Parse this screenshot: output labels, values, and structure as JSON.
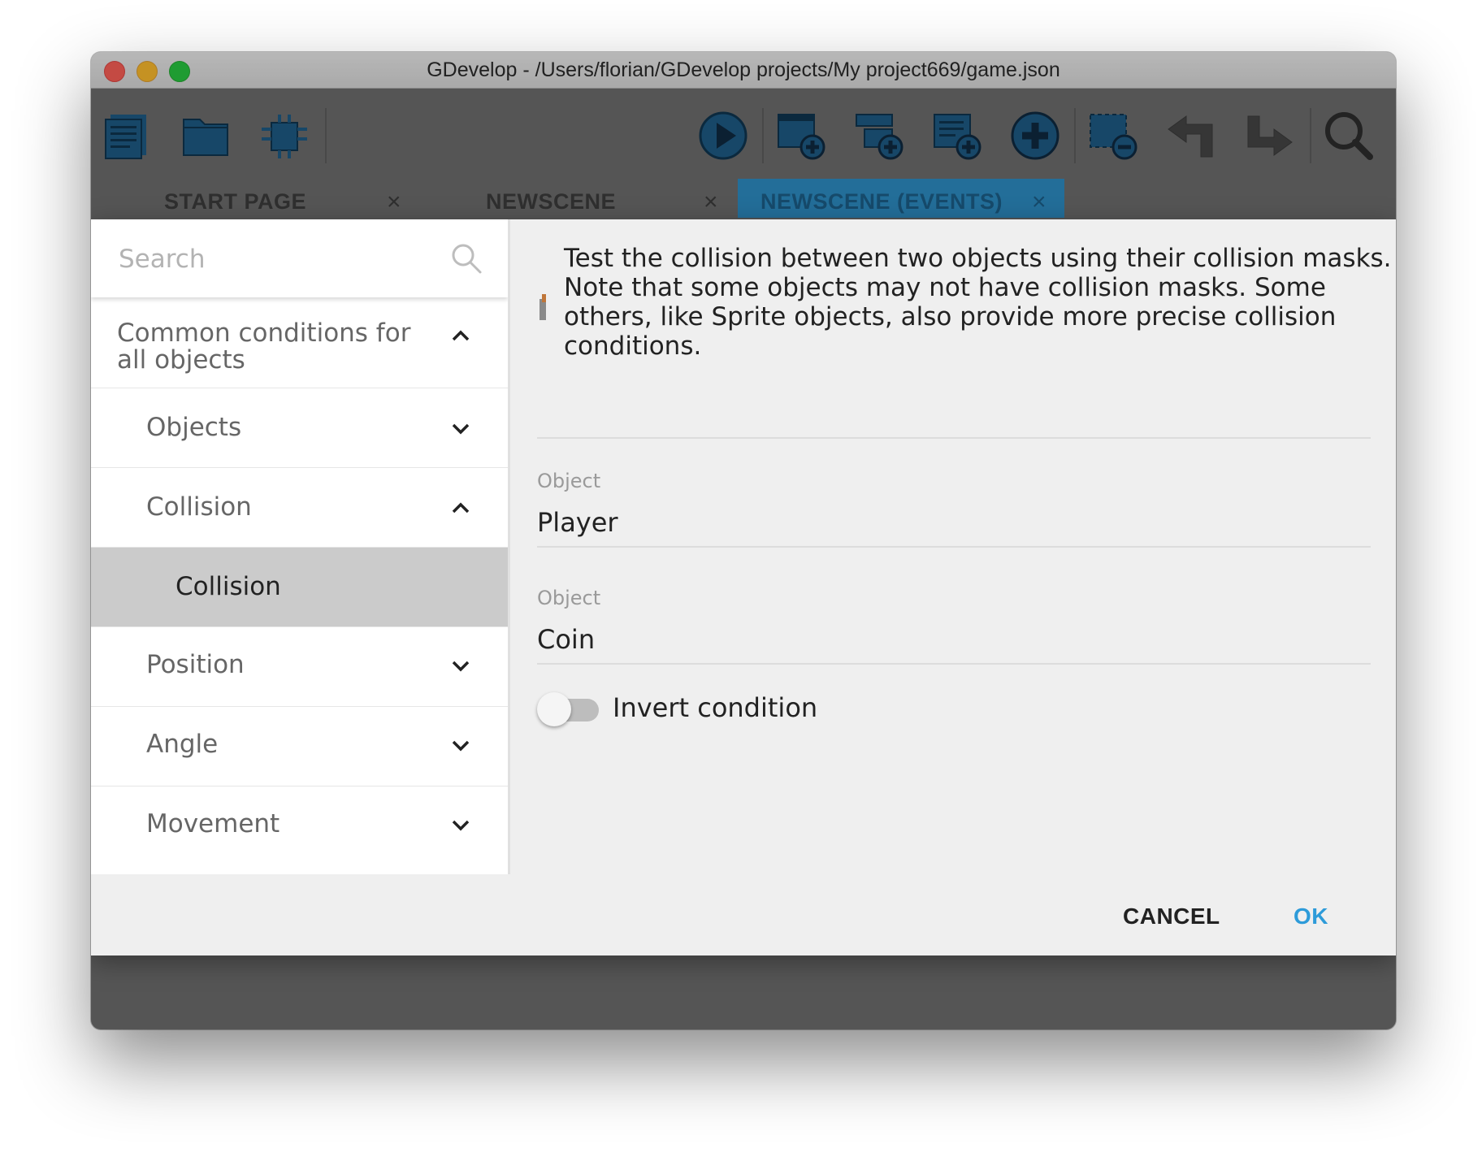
{
  "window": {
    "title": "GDevelop - /Users/florian/GDevelop projects/My project669/game.json"
  },
  "toolbar": {
    "icons": [
      "project-manager-icon",
      "open-folder-icon",
      "debugger-icon",
      "preview-play-icon",
      "add-event-icon",
      "add-subevent-icon",
      "add-comment-icon",
      "add-instruction-icon",
      "delete-selection-icon",
      "undo-icon",
      "redo-icon",
      "search-icon"
    ]
  },
  "tabs": [
    {
      "label": "START PAGE",
      "close": "×"
    },
    {
      "label": "NEWSCENE",
      "close": "×"
    },
    {
      "label": "NEWSCENE (EVENTS)",
      "close": "×",
      "active": true
    }
  ],
  "dialog": {
    "search": {
      "placeholder": "Search",
      "value": ""
    },
    "categories": {
      "common": "Common conditions for all objects",
      "objects": "Objects",
      "collision": "Collision",
      "collision_item": "Collision",
      "position": "Position",
      "angle": "Angle",
      "movement": "Movement"
    },
    "description": "Test the collision between two objects using their collision masks. Note that some objects may not have collision masks. Some others, like Sprite objects, also provide more precise collision conditions.",
    "fields": [
      {
        "label": "Object",
        "value": "Player"
      },
      {
        "label": "Object",
        "value": "Coin"
      }
    ],
    "invert": {
      "label": "Invert condition",
      "checked": false
    },
    "buttons": {
      "cancel": "CANCEL",
      "ok": "OK"
    }
  },
  "colors": {
    "accent": "#2d9bd9",
    "toolbar_icon": "#1e5b86",
    "selected_item": "#cbcbcb"
  }
}
